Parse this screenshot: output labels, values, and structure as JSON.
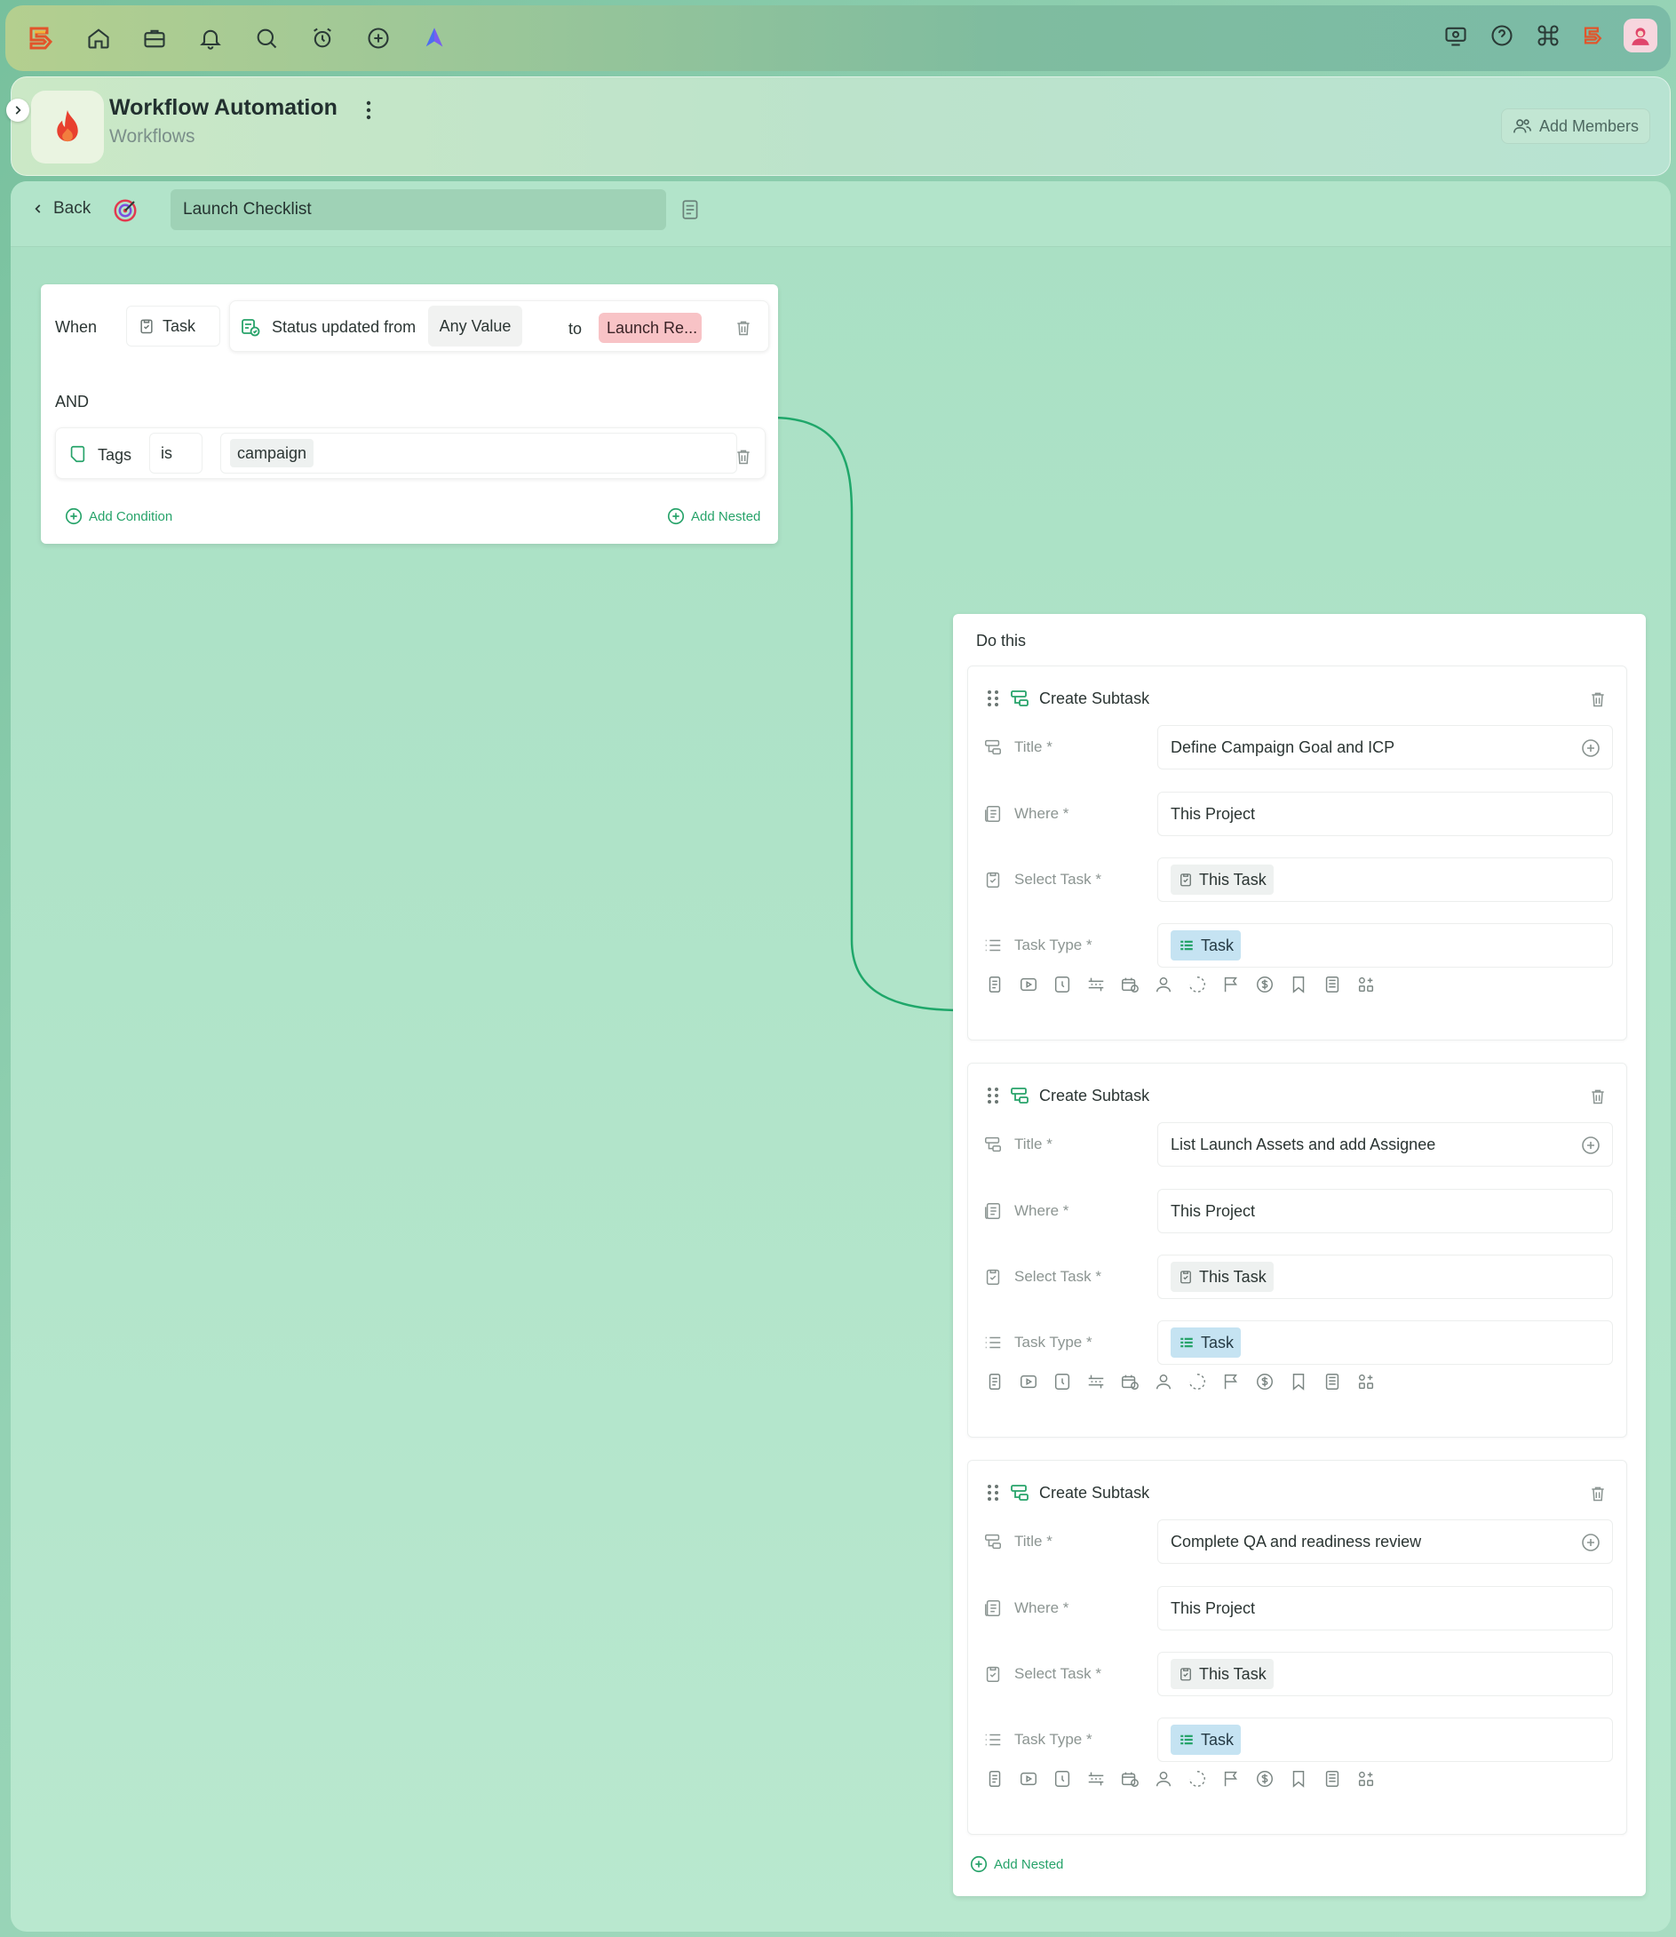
{
  "topbar": {
    "left_icons": [
      "app-logo-icon",
      "home-icon",
      "briefcase-icon",
      "bell-icon",
      "search-icon",
      "alarm-clock-icon",
      "plus-circle-icon",
      "navigation-icon"
    ],
    "right_icons": [
      "screen-record-icon",
      "help-icon",
      "command-icon",
      "brand-logo-icon",
      "user-avatar"
    ]
  },
  "project": {
    "title": "Workflow Automation",
    "subtitle": "Workflows",
    "add_members": "Add Members"
  },
  "toolbar": {
    "back": "Back",
    "workflow_name": "Launch Checklist"
  },
  "trigger": {
    "when": "When",
    "entity": "Task",
    "event": "Status updated from",
    "from_value": "Any Value",
    "to": "to",
    "to_value": "Launch Re...",
    "and": "AND",
    "condition_field": "Tags",
    "condition_op": "is",
    "condition_value": "campaign",
    "add_condition": "Add Condition",
    "add_nested": "Add Nested"
  },
  "action": {
    "heading": "Do this",
    "add_nested": "Add Nested",
    "subtasks": [
      {
        "header": "Create Subtask",
        "title_label": "Title *",
        "title": "Define Campaign Goal and ICP",
        "where_label": "Where *",
        "where": "This Project",
        "select_task_label": "Select Task *",
        "select_task": "This Task",
        "task_type_label": "Task Type *",
        "task_type": "Task"
      },
      {
        "header": "Create Subtask",
        "title_label": "Title *",
        "title": "List Launch Assets and add Assignee",
        "where_label": "Where *",
        "where": "This Project",
        "select_task_label": "Select Task *",
        "select_task": "This Task",
        "task_type_label": "Task Type *",
        "task_type": "Task"
      },
      {
        "header": "Create Subtask",
        "title_label": "Title *",
        "title": "Complete QA and readiness review",
        "where_label": "Where *",
        "where": "This Project",
        "select_task_label": "Select Task *",
        "select_task": "This Task",
        "task_type_label": "Task Type *",
        "task_type": "Task"
      }
    ],
    "field_icons": [
      "description-icon",
      "video-icon",
      "clock-icon",
      "date-range-icon",
      "calendar-icon",
      "assignee-icon",
      "status-icon",
      "priority-flag-icon",
      "currency-icon",
      "bookmark-icon",
      "calculator-icon",
      "more-fields-icon"
    ]
  },
  "colors": {
    "accent_green": "#27a36a",
    "status_pill": "#f8c3c6",
    "task_type_pill": "#c5e3f2",
    "connector": "#1fa76a"
  }
}
